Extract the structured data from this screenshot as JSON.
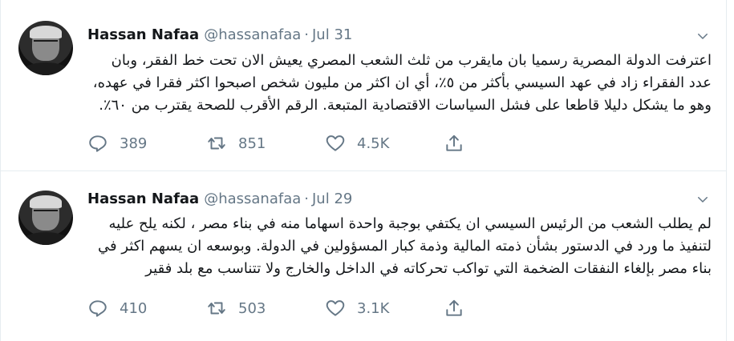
{
  "tweets": [
    {
      "author": {
        "name": "Hassan Nafaa",
        "handle": "@hassanafaa"
      },
      "separator": "·",
      "date": "Jul 31",
      "text": "اعترفت الدولة المصرية رسميا بان مايقرب من ثلث الشعب المصري يعيش الان تحت خط الفقر، وبان عدد الفقراء زاد في عهد السيسي بأكثر من ٥٪، أي ان اكثر من مليون شخص اصبحوا اكثر فقرا في عهده، وهو ما يشكل دليلا قاطعا على فشل السياسات الاقتصادية المتبعة. الرقم الأقرب للصحة يقترب من ٦٠٪.",
      "actions": {
        "reply_count": "389",
        "retweet_count": "851",
        "like_count": "4.5K"
      },
      "icons": {
        "reply": "reply-icon",
        "retweet": "retweet-icon",
        "like": "heart-icon",
        "share": "share-icon",
        "menu": "chevron-down-icon"
      }
    },
    {
      "author": {
        "name": "Hassan Nafaa",
        "handle": "@hassanafaa"
      },
      "separator": "·",
      "date": "Jul 29",
      "text": "لم يطلب الشعب من الرئيس السيسي ان يكتفي بوجبة واحدة اسهاما منه في بناء مصر ، لكنه يلح عليه لتنفيذ ما ورد في الدستور بشأن ذمته المالية وذمة كبار المسؤولين في الدولة. وبوسعه ان يسهم اكثر في بناء مصر بإلغاء النفقات الضخمة التي تواكب تحركاته في الداخل والخارج ولا تتناسب مع بلد فقير",
      "actions": {
        "reply_count": "410",
        "retweet_count": "503",
        "like_count": "3.1K"
      },
      "icons": {
        "reply": "reply-icon",
        "retweet": "retweet-icon",
        "like": "heart-icon",
        "share": "share-icon",
        "menu": "chevron-down-icon"
      }
    }
  ],
  "colors": {
    "text": "#14171a",
    "secondary": "#657786",
    "border": "#e6ecf0"
  }
}
